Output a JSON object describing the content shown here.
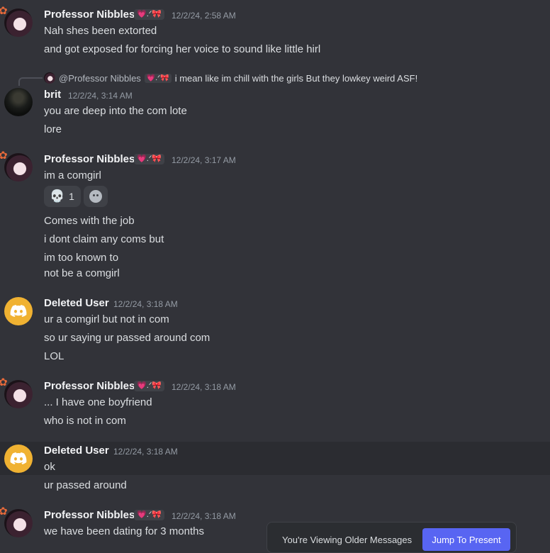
{
  "tag_text": "💗.ᐟ🎀",
  "messages": [
    {
      "author": "Professor Nibbles",
      "time": "12/2/24, 2:58 AM",
      "lines": [
        "Nah shes been extorted",
        "and got exposed for forcing her voice to sound like little hirl"
      ]
    },
    {
      "author": "brit",
      "time": "12/2/24, 3:14 AM",
      "reply": {
        "name": "@Professor Nibbles",
        "text": "i mean like im chill with the girls But they lowkey weird ASF!"
      },
      "lines": [
        "you are deep into the com lote",
        "lore"
      ]
    },
    {
      "author": "Professor Nibbles",
      "time": "12/2/24, 3:17 AM",
      "lines": [
        "im a comgirl",
        "Comes with the job",
        "i dont claim any coms but",
        "im too known to",
        "not be a comgirl"
      ],
      "reactions": [
        {
          "emoji": "💀",
          "count": "1"
        }
      ]
    },
    {
      "author": "Deleted User",
      "time": "12/2/24, 3:18 AM",
      "lines": [
        "ur a comgirl but not in com",
        "so ur saying ur passed around com",
        "LOL"
      ]
    },
    {
      "author": "Professor Nibbles",
      "time": "12/2/24, 3:18 AM",
      "lines": [
        "... I have one boyfriend",
        "who is not in com"
      ]
    },
    {
      "author": "Deleted User",
      "time": "12/2/24, 3:18 AM",
      "lines": [
        "ok",
        "ur passed around"
      ]
    },
    {
      "author": "Professor Nibbles",
      "time": "12/2/24, 3:18 AM",
      "lines": [
        "we have been dating for 3 months"
      ]
    }
  ],
  "banner": {
    "text": "You're Viewing Older Messages",
    "button": "Jump To Present"
  },
  "colors": {
    "accent": "#5865f2",
    "deleted_avatar": "#f0b232",
    "background": "#323339"
  }
}
